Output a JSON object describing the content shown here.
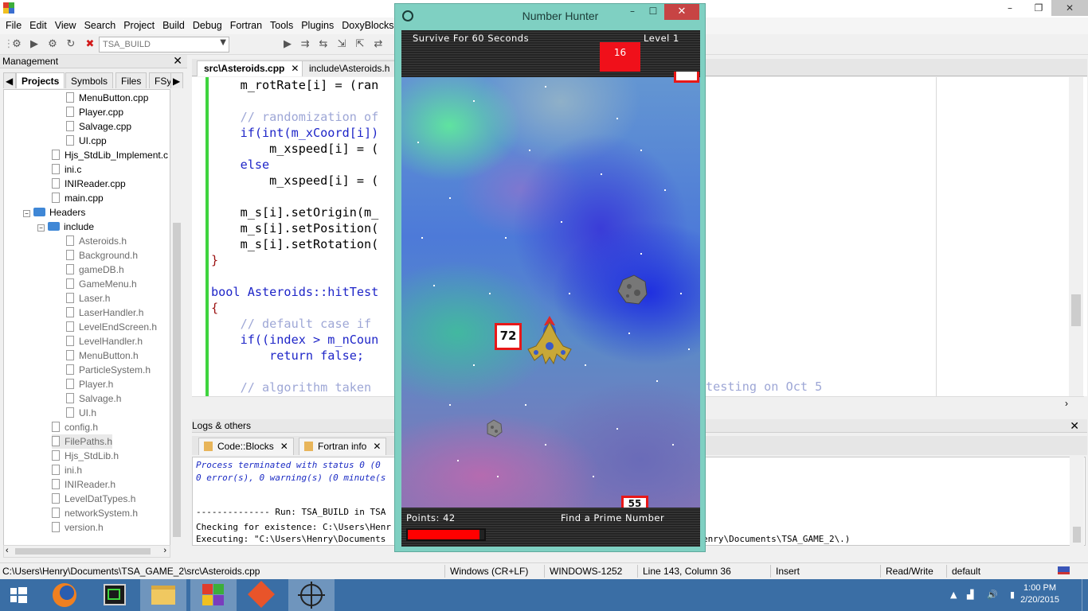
{
  "ide": {
    "menu": [
      "File",
      "Edit",
      "View",
      "Search",
      "Project",
      "Build",
      "Debug",
      "Fortran",
      "Tools",
      "Plugins",
      "DoxyBlocks"
    ],
    "build_target": "TSA_BUILD",
    "management": {
      "title": "Management",
      "tabs": [
        "Projects",
        "Symbols",
        "Files",
        "FSy"
      ],
      "tree": [
        {
          "label": "MenuButton.cpp",
          "kind": "file"
        },
        {
          "label": "Player.cpp",
          "kind": "file"
        },
        {
          "label": "Salvage.cpp",
          "kind": "file"
        },
        {
          "label": "UI.cpp",
          "kind": "file"
        },
        {
          "label": "Hjs_StdLib_Implement.c",
          "kind": "file"
        },
        {
          "label": "ini.c",
          "kind": "file"
        },
        {
          "label": "INIReader.cpp",
          "kind": "file"
        },
        {
          "label": "main.cpp",
          "kind": "file"
        },
        {
          "label": "Headers",
          "kind": "folder"
        },
        {
          "label": "include",
          "kind": "folder"
        },
        {
          "label": "Asteroids.h",
          "kind": "file"
        },
        {
          "label": "Background.h",
          "kind": "file"
        },
        {
          "label": "gameDB.h",
          "kind": "file"
        },
        {
          "label": "GameMenu.h",
          "kind": "file"
        },
        {
          "label": "Laser.h",
          "kind": "file"
        },
        {
          "label": "LaserHandler.h",
          "kind": "file"
        },
        {
          "label": "LevelEndScreen.h",
          "kind": "file"
        },
        {
          "label": "LevelHandler.h",
          "kind": "file"
        },
        {
          "label": "MenuButton.h",
          "kind": "file"
        },
        {
          "label": "ParticleSystem.h",
          "kind": "file"
        },
        {
          "label": "Player.h",
          "kind": "file"
        },
        {
          "label": "Salvage.h",
          "kind": "file"
        },
        {
          "label": "UI.h",
          "kind": "file"
        },
        {
          "label": "config.h",
          "kind": "file"
        },
        {
          "label": "FilePaths.h",
          "kind": "file"
        },
        {
          "label": "Hjs_StdLib.h",
          "kind": "file"
        },
        {
          "label": "ini.h",
          "kind": "file"
        },
        {
          "label": "INIReader.h",
          "kind": "file"
        },
        {
          "label": "LevelDatTypes.h",
          "kind": "file"
        },
        {
          "label": "networkSystem.h",
          "kind": "file"
        },
        {
          "label": "version.h",
          "kind": "file"
        }
      ]
    },
    "editor": {
      "tabs": [
        "src\\Asteroids.cpp",
        "include\\Asteroids.h"
      ],
      "code_lines": [
        "    m_rotRate[i] = (ran",
        "",
        "    // randomization of",
        "    if(int(m_xCoord[i])",
        "        m_xspeed[i] = (",
        "    else",
        "        m_xspeed[i] = (",
        "",
        "    m_s[i].setOrigin(m_",
        "    m_s[i].setPosition(",
        "    m_s[i].setRotation(",
        "}",
        "",
        "bool Asteroids::hitTest",
        "{",
        "    // default case if",
        "    if((index > m_nCoun",
        "        return false;",
        "",
        "    // algorithm taken"
      ],
      "code_tail_right": "testing on Oct 5"
    },
    "logs": {
      "title": "Logs & others",
      "tabs": [
        "Code::Blocks",
        "Fortran info"
      ],
      "lines": [
        "Process terminated with status 0 (0",
        "0 error(s), 0 warning(s) (0 minute(s",
        "",
        "",
        "-------------- Run: TSA_BUILD in TSA",
        "Checking for existence: C:\\Users\\Henr",
        "Executing: \"C:\\Users\\Henry\\Documents"
      ],
      "line_tail": "enry\\Documents\\TSA_GAME_2\\.)"
    },
    "status": {
      "path": "C:\\Users\\Henry\\Documents\\TSA_GAME_2\\src\\Asteroids.cpp",
      "eol": "Windows (CR+LF)",
      "encoding": "WINDOWS-1252",
      "position": "Line 143, Column 36",
      "mode": "Insert",
      "access": "Read/Write",
      "profile": "default"
    }
  },
  "game": {
    "window_title": "Number Hunter",
    "objective": "Survive For 60 Seconds",
    "level": "Level 1",
    "timer": "16",
    "number_near_ship": "72",
    "number_bottom": "55",
    "points": "Points: 42",
    "hint": "Find a Prime Number",
    "health_fraction": 0.94,
    "colors": {
      "hud": "#2b2b2b",
      "timer": "#f0101a",
      "box_border": "#e81818",
      "health": "#ff0000"
    }
  },
  "taskbar": {
    "time": "1:00 PM",
    "date": "2/20/2015",
    "apps": [
      "start-icon",
      "firefox-icon",
      "codeblocks-icon",
      "file-explorer-icon",
      "office-icon",
      "git-icon",
      "number-hunter-icon"
    ]
  }
}
